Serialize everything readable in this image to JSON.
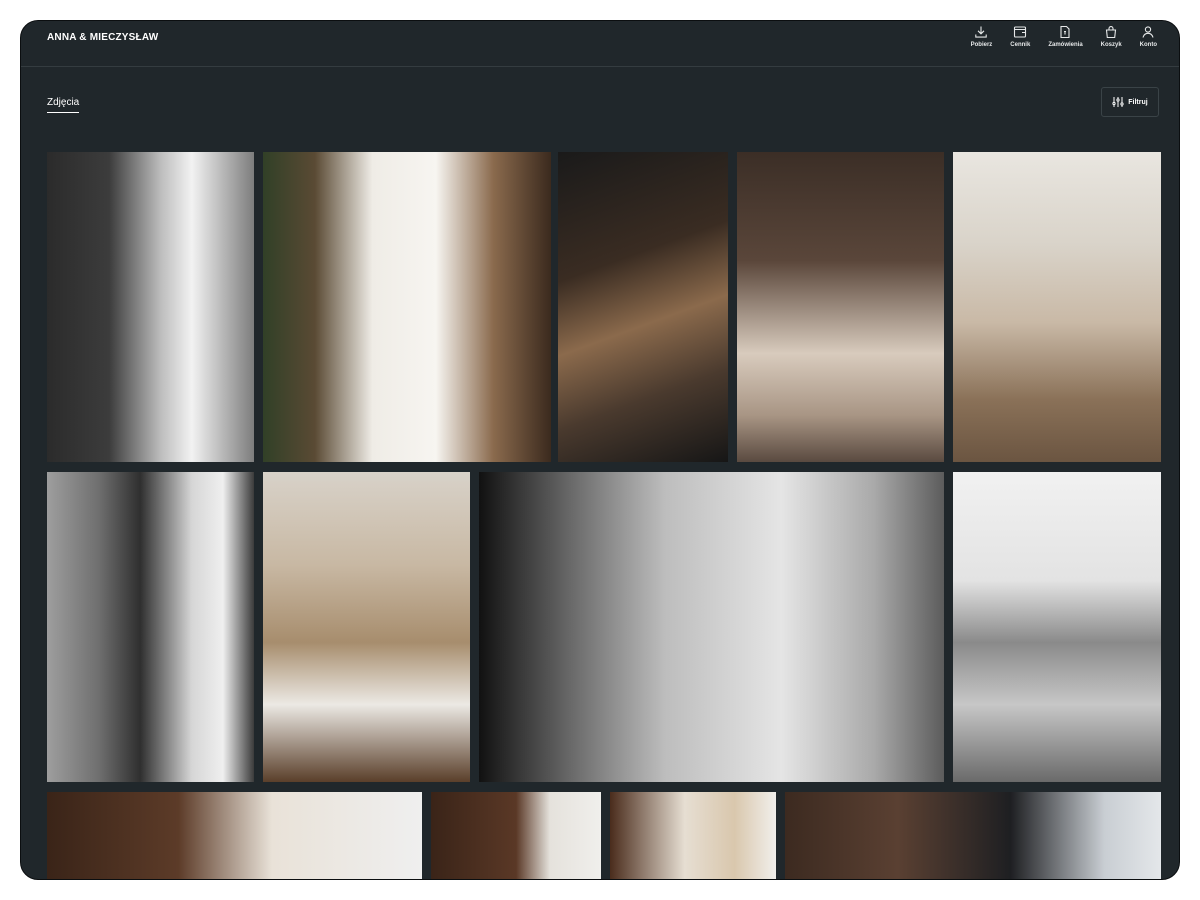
{
  "header": {
    "brand": "ANNA & MIECZYSŁAW",
    "nav": [
      {
        "label": "Pobierz",
        "icon": "download-icon"
      },
      {
        "label": "Cennik",
        "icon": "wallet-icon"
      },
      {
        "label": "Zamówienia",
        "icon": "document-icon"
      },
      {
        "label": "Koszyk",
        "icon": "bag-icon"
      },
      {
        "label": "Konto",
        "icon": "user-icon"
      }
    ]
  },
  "tabs": {
    "active": "Zdjęcia"
  },
  "filter": {
    "label": "Filtruj",
    "icon": "sliders-icon"
  },
  "colors": {
    "background": "#20272b",
    "text": "#ffffff",
    "divider": "#343c40"
  }
}
